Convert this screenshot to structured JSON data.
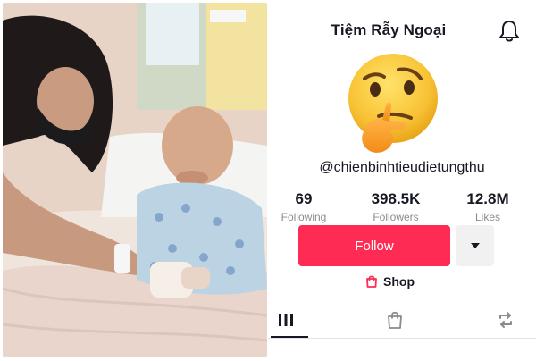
{
  "photo": {
    "description_icon": "photo-image"
  },
  "profile": {
    "name": "Tiệm Rẫy Ngoại",
    "username": "@chienbinhtieudietungthu",
    "avatar_icon": "thinking-face-icon",
    "stats": [
      {
        "value": "69",
        "label": "Following"
      },
      {
        "value": "398.5K",
        "label": "Followers"
      },
      {
        "value": "12.8M",
        "label": "Likes"
      }
    ],
    "follow_label": "Follow",
    "shop_label": "Shop"
  },
  "colors": {
    "accent": "#fe2c55",
    "text": "#161823",
    "muted": "#8a8b91"
  }
}
